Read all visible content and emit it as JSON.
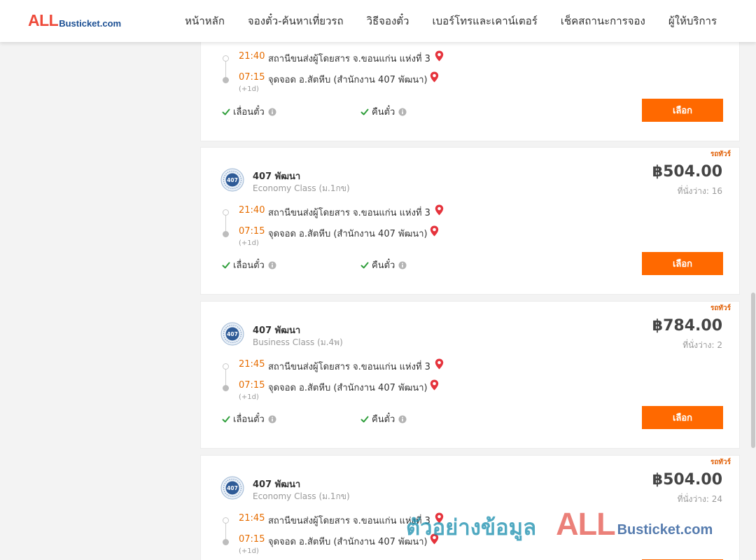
{
  "header": {
    "logo_all": "ALL",
    "logo_rest": "Busticket.com",
    "nav": [
      "หน้าหลัก",
      "จองตั๋ว-ค้นหาเที่ยวรถ",
      "วิธีจองตั๋ว",
      "เบอร์โทรและเคาน์เตอร์",
      "เช็คสถานะการจอง",
      "ผู้ให้บริการ"
    ]
  },
  "cards": [
    {
      "dep_time": "21:40",
      "dep_stop": "สถานีขนส่งผู้โดยสาร จ.ขอนแก่น แห่งที่ 3",
      "arr_time": "07:15",
      "arr_stop": "จุดจอด อ.สัตหีบ (สำนักงาน 407 พัฒนา)",
      "day_offset": "(+1d)",
      "policy_change": "เลื่อนตั๋ว",
      "policy_refund": "คืนตั๋ว",
      "button": "เลือก"
    },
    {
      "tag": "รถทัวร์",
      "operator": "407 พัฒนา",
      "class": "Economy Class (ม.1กข)",
      "price": "฿504.00",
      "seats": "ที่นั่งว่าง: 16",
      "dep_time": "21:40",
      "dep_stop": "สถานีขนส่งผู้โดยสาร จ.ขอนแก่น แห่งที่ 3",
      "arr_time": "07:15",
      "arr_stop": "จุดจอด อ.สัตหีบ (สำนักงาน 407 พัฒนา)",
      "day_offset": "(+1d)",
      "policy_change": "เลื่อนตั๋ว",
      "policy_refund": "คืนตั๋ว",
      "button": "เลือก"
    },
    {
      "tag": "รถทัวร์",
      "operator": "407 พัฒนา",
      "class": "Business Class (ม.4พ)",
      "price": "฿784.00",
      "seats": "ที่นั่งว่าง: 2",
      "dep_time": "21:45",
      "dep_stop": "สถานีขนส่งผู้โดยสาร จ.ขอนแก่น แห่งที่ 3",
      "arr_time": "07:15",
      "arr_stop": "จุดจอด อ.สัตหีบ (สำนักงาน 407 พัฒนา)",
      "day_offset": "(+1d)",
      "policy_change": "เลื่อนตั๋ว",
      "policy_refund": "คืนตั๋ว",
      "button": "เลือก"
    },
    {
      "tag": "รถทัวร์",
      "operator": "407 พัฒนา",
      "class": "Economy Class (ม.1กข)",
      "price": "฿504.00",
      "seats": "ที่นั่งว่าง: 24",
      "dep_time": "21:45",
      "dep_stop": "สถานีขนส่งผู้โดยสาร จ.ขอนแก่น แห่งที่ 3",
      "arr_time": "07:15",
      "arr_stop": "จุดจอด อ.สัตหีบ (สำนักงาน 407 พัฒนา)",
      "day_offset": "(+1d)"
    }
  ],
  "operator_logo_text": "407",
  "watermark": {
    "thai": "ตัวอย่างข้อมูล",
    "all": "ALL",
    "rest": "Busticket.com"
  },
  "colors": {
    "accent": "#ff6900",
    "time": "#e66c00",
    "check": "#2e9e3a",
    "pin": "#e5333c",
    "logo_red": "#ee4a3a",
    "logo_blue": "#1b4f93"
  }
}
